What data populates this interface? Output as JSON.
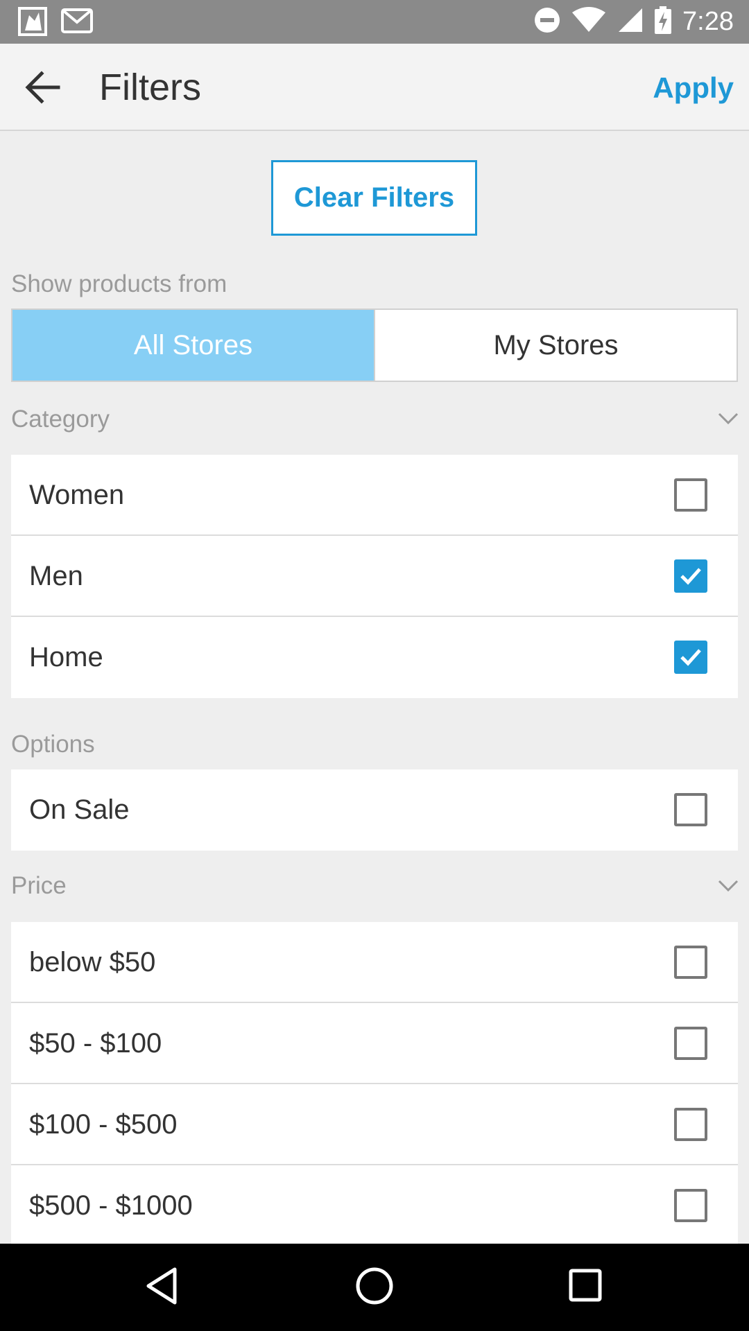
{
  "status_bar": {
    "time": "7:28",
    "icons": [
      "photo-notification-icon",
      "gmail-icon",
      "do-not-disturb-icon",
      "wifi-icon",
      "signal-icon",
      "battery-charging-icon"
    ]
  },
  "toolbar": {
    "title": "Filters",
    "apply_label": "Apply",
    "back_icon": "arrow-back-icon"
  },
  "clear_filters_label": "Clear Filters",
  "show_products": {
    "label": "Show products from",
    "options": [
      {
        "label": "All Stores",
        "selected": true
      },
      {
        "label": "My Stores",
        "selected": false
      }
    ]
  },
  "category": {
    "label": "Category",
    "items": [
      {
        "label": "Women",
        "checked": false
      },
      {
        "label": "Men",
        "checked": true
      },
      {
        "label": "Home",
        "checked": true
      }
    ]
  },
  "options": {
    "label": "Options",
    "items": [
      {
        "label": "On Sale",
        "checked": false
      }
    ]
  },
  "price": {
    "label": "Price",
    "items": [
      {
        "label": "below $50",
        "checked": false
      },
      {
        "label": "$50 - $100",
        "checked": false
      },
      {
        "label": "$100 - $500",
        "checked": false
      },
      {
        "label": "$500 - $1000",
        "checked": false
      }
    ]
  },
  "colors": {
    "accent": "#1e98d6",
    "segment_active": "#87cff5",
    "status_bar": "#8a8a8a"
  },
  "nav_bar": {
    "buttons": [
      "back-triangle-icon",
      "home-circle-icon",
      "recents-square-icon"
    ]
  }
}
